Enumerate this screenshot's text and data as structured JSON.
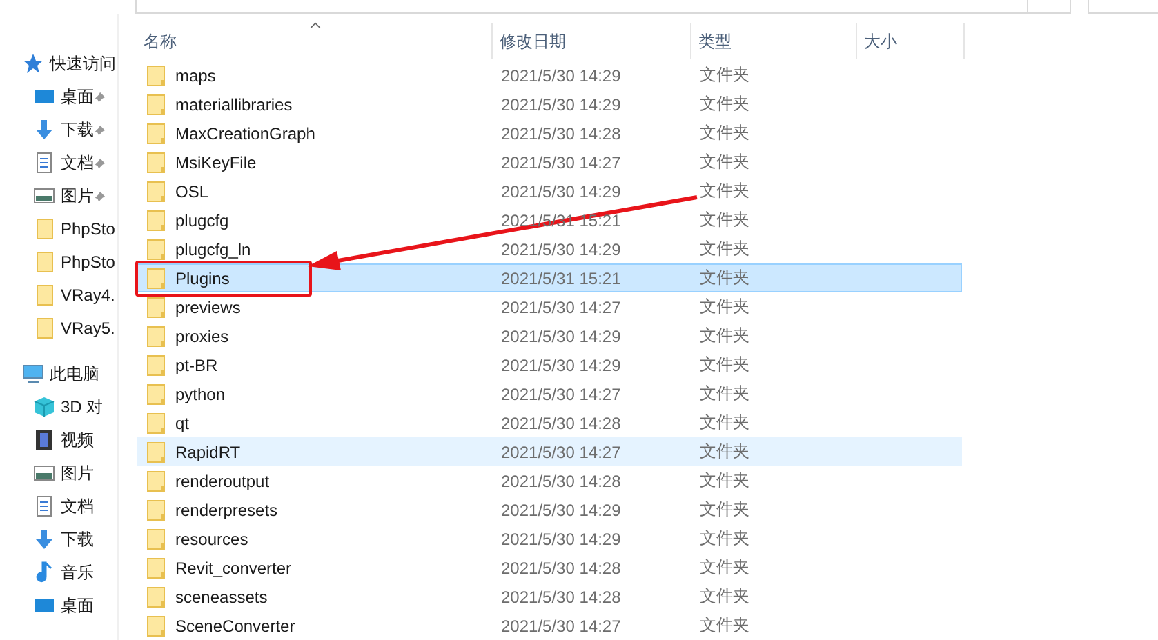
{
  "sidebar": {
    "items": [
      {
        "label": "快速访问",
        "kind": "star",
        "pinned": false,
        "section": true
      },
      {
        "label": "桌面",
        "kind": "desktop",
        "pinned": true,
        "section": false
      },
      {
        "label": "下载",
        "kind": "download",
        "pinned": true,
        "section": false
      },
      {
        "label": "文档",
        "kind": "document",
        "pinned": true,
        "section": false
      },
      {
        "label": "图片",
        "kind": "picture",
        "pinned": true,
        "section": false
      },
      {
        "label": "PhpSto",
        "kind": "folder",
        "pinned": false,
        "section": false
      },
      {
        "label": "PhpSto",
        "kind": "folder",
        "pinned": false,
        "section": false
      },
      {
        "label": "VRay4.",
        "kind": "folder",
        "pinned": false,
        "section": false
      },
      {
        "label": "VRay5.",
        "kind": "folder",
        "pinned": false,
        "section": false
      },
      {
        "label": "此电脑",
        "kind": "pc",
        "pinned": false,
        "section": true
      },
      {
        "label": "3D 对",
        "kind": "cube",
        "pinned": false,
        "section": false
      },
      {
        "label": "视频",
        "kind": "video",
        "pinned": false,
        "section": false
      },
      {
        "label": "图片",
        "kind": "picture",
        "pinned": false,
        "section": false
      },
      {
        "label": "文档",
        "kind": "document",
        "pinned": false,
        "section": false
      },
      {
        "label": "下载",
        "kind": "download",
        "pinned": false,
        "section": false
      },
      {
        "label": "音乐",
        "kind": "music",
        "pinned": false,
        "section": false
      },
      {
        "label": "桌面",
        "kind": "desktop",
        "pinned": false,
        "section": false
      }
    ]
  },
  "table": {
    "columns": [
      "名称",
      "修改日期",
      "类型",
      "大小"
    ],
    "rows": [
      {
        "name": "maps",
        "date": "2021/5/30 14:29",
        "type": "文件夹",
        "selected": false,
        "hovered": false
      },
      {
        "name": "materiallibraries",
        "date": "2021/5/30 14:29",
        "type": "文件夹",
        "selected": false,
        "hovered": false
      },
      {
        "name": "MaxCreationGraph",
        "date": "2021/5/30 14:28",
        "type": "文件夹",
        "selected": false,
        "hovered": false
      },
      {
        "name": "MsiKeyFile",
        "date": "2021/5/30 14:27",
        "type": "文件夹",
        "selected": false,
        "hovered": false
      },
      {
        "name": "OSL",
        "date": "2021/5/30 14:29",
        "type": "文件夹",
        "selected": false,
        "hovered": false
      },
      {
        "name": "plugcfg",
        "date": "2021/5/31 15:21",
        "type": "文件夹",
        "selected": false,
        "hovered": false
      },
      {
        "name": "plugcfg_ln",
        "date": "2021/5/30 14:29",
        "type": "文件夹",
        "selected": false,
        "hovered": false
      },
      {
        "name": "Plugins",
        "date": "2021/5/31 15:21",
        "type": "文件夹",
        "selected": true,
        "hovered": false
      },
      {
        "name": "previews",
        "date": "2021/5/30 14:27",
        "type": "文件夹",
        "selected": false,
        "hovered": false
      },
      {
        "name": "proxies",
        "date": "2021/5/30 14:29",
        "type": "文件夹",
        "selected": false,
        "hovered": false
      },
      {
        "name": "pt-BR",
        "date": "2021/5/30 14:29",
        "type": "文件夹",
        "selected": false,
        "hovered": false
      },
      {
        "name": "python",
        "date": "2021/5/30 14:27",
        "type": "文件夹",
        "selected": false,
        "hovered": false
      },
      {
        "name": "qt",
        "date": "2021/5/30 14:28",
        "type": "文件夹",
        "selected": false,
        "hovered": false
      },
      {
        "name": "RapidRT",
        "date": "2021/5/30 14:27",
        "type": "文件夹",
        "selected": false,
        "hovered": true
      },
      {
        "name": "renderoutput",
        "date": "2021/5/30 14:28",
        "type": "文件夹",
        "selected": false,
        "hovered": false
      },
      {
        "name": "renderpresets",
        "date": "2021/5/30 14:29",
        "type": "文件夹",
        "selected": false,
        "hovered": false
      },
      {
        "name": "resources",
        "date": "2021/5/30 14:29",
        "type": "文件夹",
        "selected": false,
        "hovered": false
      },
      {
        "name": "Revit_converter",
        "date": "2021/5/30 14:28",
        "type": "文件夹",
        "selected": false,
        "hovered": false
      },
      {
        "name": "sceneassets",
        "date": "2021/5/30 14:28",
        "type": "文件夹",
        "selected": false,
        "hovered": false
      },
      {
        "name": "SceneConverter",
        "date": "2021/5/30 14:27",
        "type": "文件夹",
        "selected": false,
        "hovered": false
      }
    ]
  }
}
